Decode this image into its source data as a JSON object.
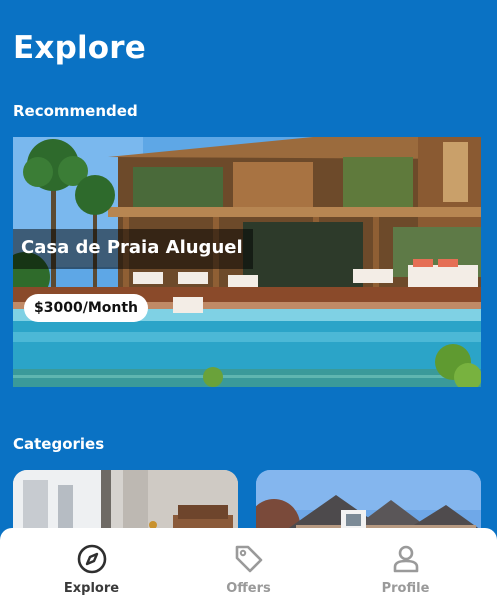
{
  "header": {
    "title": "Explore"
  },
  "sections": {
    "recommended": "Recommended",
    "categories": "Categories"
  },
  "recommended": {
    "title": "Casa de Praia Aluguel",
    "price": "$3000/Month"
  },
  "nav": {
    "items": [
      {
        "label": "Explore",
        "icon": "compass-icon",
        "active": true
      },
      {
        "label": "Offers",
        "icon": "tag-icon",
        "active": false
      },
      {
        "label": "Profile",
        "icon": "person-icon",
        "active": false
      }
    ]
  },
  "colors": {
    "background": "#0a72c4",
    "nav_background": "#ffffff",
    "nav_active": "#3a3a3a",
    "nav_inactive": "#9a9a9a"
  }
}
